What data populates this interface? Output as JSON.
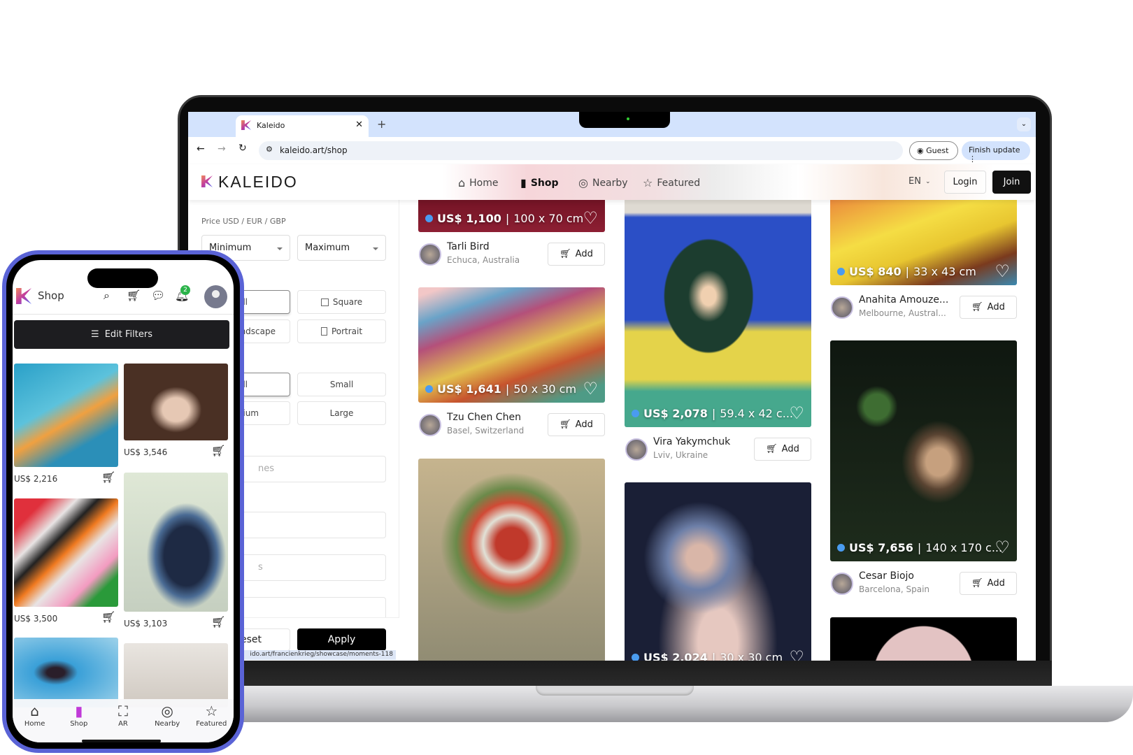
{
  "browser": {
    "tab_title": "Kaleido",
    "new_tab": "+",
    "url": "kaleido.art/shop",
    "guest_label": "Guest",
    "update_label": "Finish update",
    "status_url": "ido.art/francienkrieg/showcase/moments-118"
  },
  "site": {
    "logo": "KALEIDO",
    "nav": [
      {
        "label": "Home",
        "icon": "home-icon"
      },
      {
        "label": "Shop",
        "icon": "bag-icon",
        "active": true
      },
      {
        "label": "Nearby",
        "icon": "location-pin-icon"
      },
      {
        "label": "Featured",
        "icon": "star-icon"
      }
    ],
    "language": "EN",
    "login": "Login",
    "join": "Join"
  },
  "filters": {
    "price_label": "Price USD / EUR / GBP",
    "min_placeholder": "Minimum",
    "max_placeholder": "Maximum",
    "orientation_label_fragment": "n",
    "orientation_options": [
      "All",
      "Square",
      "Landscape",
      "Portrait"
    ],
    "size_options": [
      "All",
      "Small",
      "Medium",
      "Large"
    ],
    "input_fragments": [
      "nes",
      "",
      "s",
      ""
    ],
    "reset": "Reset",
    "apply": "Apply"
  },
  "artworks": [
    {
      "price": "US$ 1,100",
      "size": "100 x 70 cm",
      "artist": "Tarli Bird",
      "location": "Echuca, Australia"
    },
    {
      "price": "US$ 1,641",
      "size": "50 x 30 cm",
      "artist": "Tzu Chen Chen",
      "location": "Basel, Switzerland"
    },
    {},
    {
      "price": "US$ 2,078",
      "size": "59.4 x 42 c...",
      "artist": "Vira Yakymchuk",
      "location": "Lviv, Ukraine"
    },
    {
      "price": "US$ 2,024",
      "size": "30 x 30 cm"
    },
    {
      "price": "US$ 840",
      "size": "33 x 43 cm",
      "artist": "Anahita Amouze...",
      "location": "Melbourne, Austral..."
    },
    {
      "price": "US$ 7,656",
      "size": "140 x 170 c...",
      "artist": "Cesar Biojo",
      "location": "Barcelona, Spain"
    },
    {}
  ],
  "add_label": "Add",
  "phone": {
    "title": "Shop",
    "notification_count": "2",
    "edit_filters": "Edit Filters",
    "items": [
      {
        "price": "US$ 2,216"
      },
      {
        "price": "US$ 3,546"
      },
      {
        "price": "US$ 3,500"
      },
      {
        "price": "US$ 3,103"
      },
      {},
      {}
    ],
    "nav": [
      {
        "label": "Home",
        "icon": "home-icon"
      },
      {
        "label": "Shop",
        "icon": "bag-icon",
        "active": true
      },
      {
        "label": "AR",
        "icon": "ar-icon"
      },
      {
        "label": "Nearby",
        "icon": "location-pin-icon"
      },
      {
        "label": "Featured",
        "icon": "star-icon"
      }
    ]
  },
  "colors": {
    "accent_dot": "#4a9bf0",
    "phone_frame": "#5a63d6",
    "join_bg": "#111111",
    "badge": "#2bb34a"
  }
}
